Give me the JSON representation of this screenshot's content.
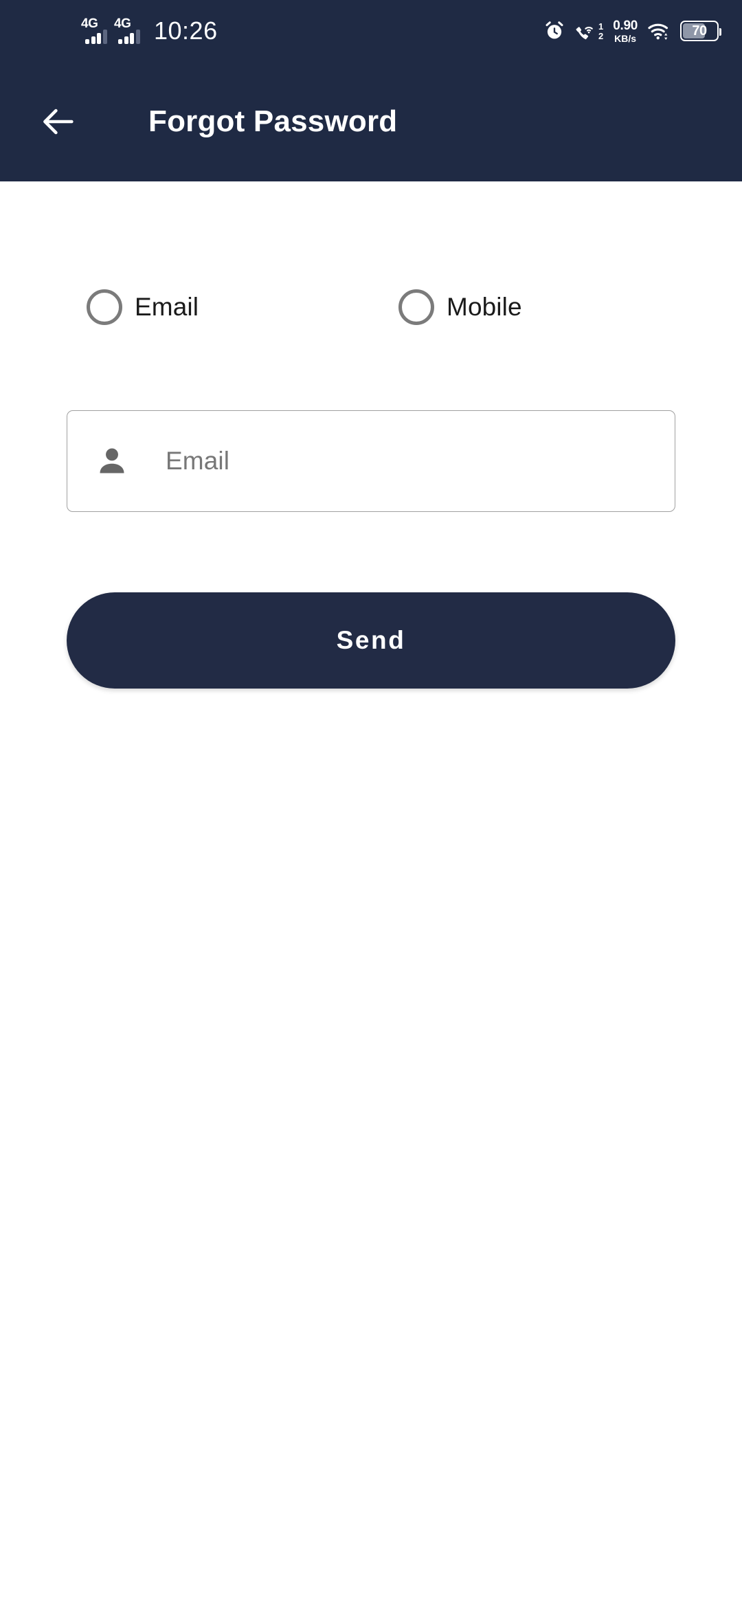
{
  "statusbar": {
    "sim1": {
      "network": "4G",
      "icon": "signal-bars-icon",
      "bars_active": 3,
      "bars_total": 4
    },
    "sim2": {
      "network": "4G",
      "icon": "signal-bars-icon",
      "bars_active": 3,
      "bars_total": 4
    },
    "time": "10:26",
    "alarm_icon": "alarm-clock-icon",
    "volte": {
      "icon": "wifi-calling-icon",
      "line1": "1",
      "line2": "2"
    },
    "network_speed": {
      "value": "0.90",
      "unit": "KB/s"
    },
    "wifi_icon": "wifi-icon",
    "battery": {
      "percent": "70",
      "level": 70
    }
  },
  "appbar": {
    "back_icon": "back-arrow-icon",
    "title": "Forgot Password",
    "background": "#1f2a44"
  },
  "form": {
    "recovery_method": {
      "selected": "",
      "options": [
        {
          "value": "email",
          "label": "Email",
          "selected": false
        },
        {
          "value": "mobile",
          "label": "Mobile",
          "selected": false
        }
      ]
    },
    "identifier_input": {
      "icon": "person-icon",
      "value": "",
      "placeholder": "Email"
    },
    "submit_button": {
      "label": "Send",
      "background": "#222b45",
      "text_color": "#ffffff"
    }
  },
  "theme": {
    "primary": "#1f2a44",
    "button": "#222b45",
    "page_background": "#ffffff",
    "border": "#a0a0a0",
    "muted_text": "#777777",
    "radio_border": "#7b7b7b"
  }
}
